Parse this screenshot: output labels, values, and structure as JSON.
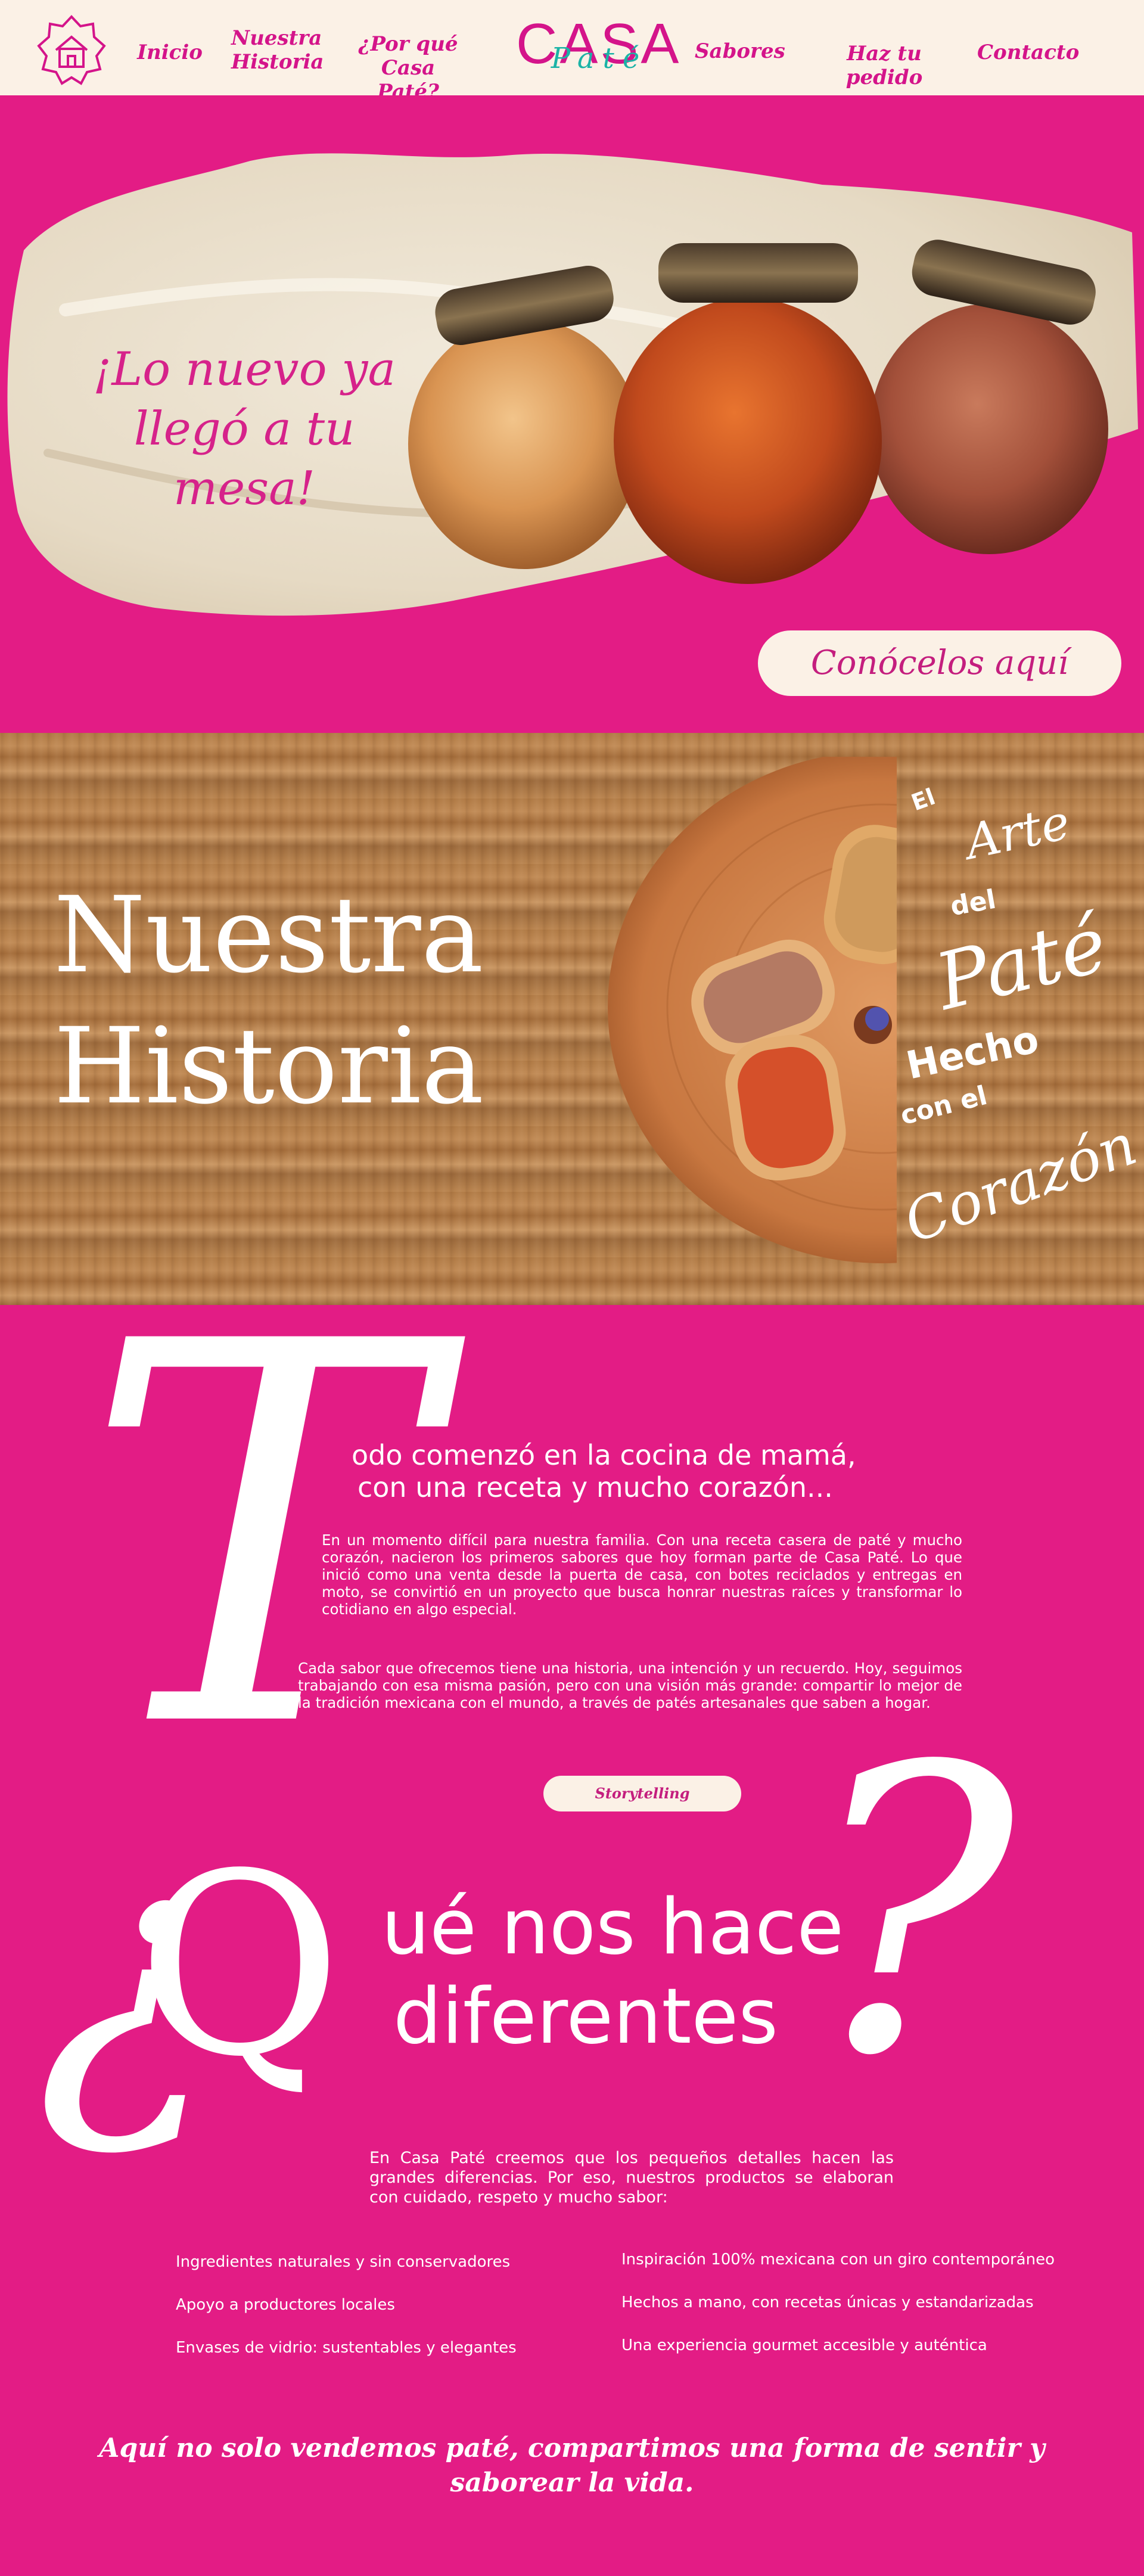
{
  "nav": {
    "home_icon": "house-icon",
    "links": [
      {
        "label": "Inicio"
      },
      {
        "label_line1": "Nuestra",
        "label_line2": "Historia"
      },
      {
        "label_line1": "¿Por qué",
        "label_line2": "Casa Paté?"
      },
      {
        "label": "Sabores"
      },
      {
        "label": "Haz tu pedido"
      },
      {
        "label": "Contacto"
      }
    ],
    "logo_top": "CASA",
    "logo_script": "Paté"
  },
  "hero": {
    "headline_line1": "¡Lo nuevo ya",
    "headline_line2": "llegó a tu mesa!",
    "cta_label": "Conócelos aquí"
  },
  "history": {
    "title_line1": "Nuestra",
    "title_line2": "Historia",
    "lettering": [
      "El",
      "Arte",
      "del",
      "Paté",
      "Hecho",
      "con el",
      "Corazón"
    ]
  },
  "story": {
    "dropcap": "T",
    "lead_line1": "odo comenzó en la cocina de mamá,",
    "lead_line2": "con una receta y mucho corazón...",
    "paragraph1": "En un momento difícil para nuestra familia. Con una receta casera de paté y mucho corazón, nacieron los primeros sabores que hoy forman parte de Casa Paté. Lo que inició como una venta desde la puerta de casa, con botes reciclados y entregas en moto, se convirtió en un proyecto que busca honrar nuestras raíces y transformar lo cotidiano en algo especial.",
    "paragraph2": "Cada sabor que ofrecemos tiene una historia, una intención y un recuerdo. Hoy, seguimos trabajando con esa misma pasión, pero con una visión más grande: compartir lo mejor de la tradición mexicana con el mundo, a través de patés artesanales que saben a hogar.",
    "tag": "Storytelling"
  },
  "different": {
    "open_q": "¿",
    "big_q": "Q",
    "title_line1": "ué nos hace",
    "title_line2": "diferentes",
    "close_q": "?",
    "intro": "En Casa Paté creemos que los pequeños detalles hacen las grandes diferencias. Por eso, nuestros productos se elaboran con cuidado, respeto y mucho sabor:",
    "features_left": [
      "Ingredientes naturales y sin conservadores",
      "Apoyo a productores locales",
      "Envases de vidrio: sustentables y elegantes"
    ],
    "features_right": [
      "Inspiración 100% mexicana con un giro contemporáneo",
      "Hechos a mano, con recetas únicas y estandarizadas",
      "Una experiencia gourmet accesible y auténtica"
    ],
    "closing_line1": "Aquí no solo vendemos paté, compartimos una forma de sentir y",
    "closing_line2": "saborear la vida."
  },
  "colors": {
    "brand_pink": "#e31c85",
    "cream": "#fbf1e6",
    "nav_text": "#d4148a",
    "teal_accent": "#1bb3a6"
  }
}
